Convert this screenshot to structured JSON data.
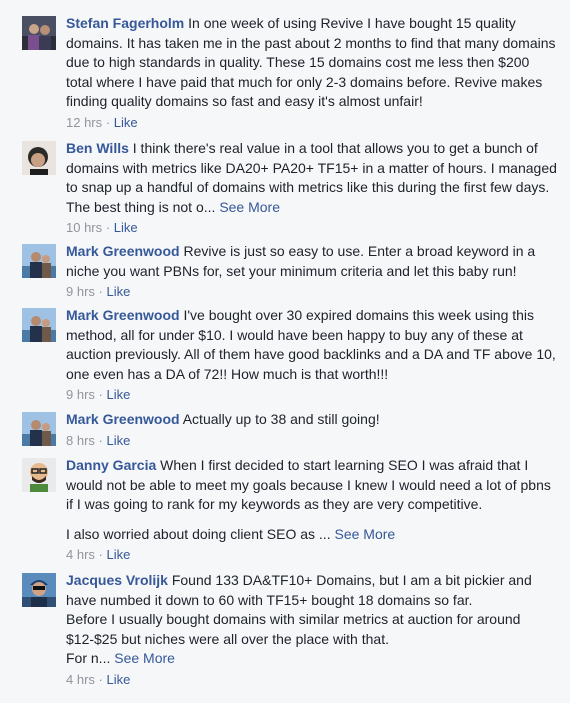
{
  "comments": [
    {
      "name": "Stefan Fagerholm",
      "text": "In one week of using Revive I have bought 15 quality domains. It has taken me in the past about 2 months to find that many domains due to high standards in quality. These 15 domains cost me less then $200 total where I have paid that much for only 2-3 domains before. Revive makes finding quality domains so fast and easy it's almost unfair!",
      "time": "12 hrs",
      "sep": "·",
      "like": "Like"
    },
    {
      "name": "Ben Wills",
      "text": "I think there's real value in a tool that allows you to get a bunch of domains with metrics like DA20+ PA20+ TF15+ in a matter of hours. I managed to snap up a handful of domains with metrics like this during the first few days. The best thing is not o...",
      "see_more": "See More",
      "time": "10 hrs",
      "sep": "·",
      "like": "Like"
    },
    {
      "name": "Mark Greenwood",
      "text": "Revive is just so easy to use. Enter a broad keyword in a niche you want PBNs for, set your minimum criteria and let this baby run!",
      "time": "9 hrs",
      "sep": "·",
      "like": "Like"
    },
    {
      "name": "Mark Greenwood",
      "text": "I've bought over 30 expired domains this week using this method, all for under $10. I would have been happy to buy any of these at auction previously. All of them have good backlinks and a DA and TF above 10, one even has a DA of 72!! How much is that worth!!!",
      "time": "9 hrs",
      "sep": "·",
      "like": "Like"
    },
    {
      "name": "Mark Greenwood",
      "text": "Actually up to 38 and still going!",
      "time": "8 hrs",
      "sep": "·",
      "like": "Like"
    },
    {
      "name": "Danny Garcia",
      "text": "When I first decided to start learning SEO I was afraid that I would not be able to meet my goals because I knew I would need a lot of pbns if I was going to rank for my keywords as they are very competitive.",
      "text2": "I also worried about doing client SEO as ...",
      "see_more": "See More",
      "time": "4 hrs",
      "sep": "·",
      "like": "Like"
    },
    {
      "name": "Jacques Vrolijk",
      "text": "Found 133 DA&TF10+ Domains, but I am a bit pickier and have numbed it down to 60 with TF15+ bought 18 domains so far.",
      "text2": "Before I usually bought domains with similar metrics at auction for around $12-$25 but niches were all over the place with that.",
      "text3": "For n...",
      "see_more": "See More",
      "time": "4 hrs",
      "sep": "·",
      "like": "Like"
    }
  ]
}
